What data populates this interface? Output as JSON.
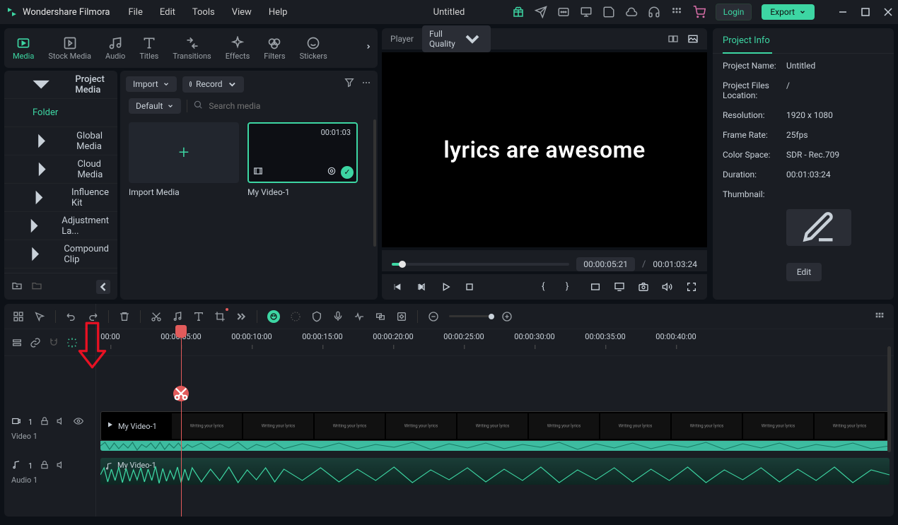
{
  "app_name": "Wondershare Filmora",
  "menu": [
    "File",
    "Edit",
    "Tools",
    "View",
    "Help"
  ],
  "doc_title": "Untitled",
  "login": "Login",
  "export": "Export",
  "tabs": [
    {
      "label": "Media",
      "active": true
    },
    {
      "label": "Stock Media"
    },
    {
      "label": "Audio"
    },
    {
      "label": "Titles"
    },
    {
      "label": "Transitions"
    },
    {
      "label": "Effects"
    },
    {
      "label": "Filters"
    },
    {
      "label": "Stickers"
    }
  ],
  "sidebar": {
    "items": [
      {
        "label": "Project Media",
        "head": true
      },
      {
        "label": "Folder",
        "flat": true
      },
      {
        "label": "Global Media"
      },
      {
        "label": "Cloud Media"
      },
      {
        "label": "Influence Kit"
      },
      {
        "label": "Adjustment La..."
      },
      {
        "label": "Compound Clip"
      }
    ]
  },
  "media_panel": {
    "import": "Import",
    "record": "Record",
    "default_dd": "Default",
    "search_placeholder": "Search media",
    "import_label": "Import Media",
    "clip": {
      "name": "My Video-1",
      "duration": "00:01:03"
    }
  },
  "player": {
    "label": "Player",
    "quality": "Full Quality",
    "preview_text": "lyrics are awesome",
    "current": "00:00:05:21",
    "total": "00:01:03:24"
  },
  "project_info": {
    "tab": "Project Info",
    "rows": {
      "name": {
        "label": "Project Name:",
        "value": "Untitled"
      },
      "location": {
        "label": "Project Files Location:",
        "value": "/"
      },
      "resolution": {
        "label": "Resolution:",
        "value": "1920 x 1080"
      },
      "framerate": {
        "label": "Frame Rate:",
        "value": "25fps"
      },
      "colorspace": {
        "label": "Color Space:",
        "value": "SDR - Rec.709"
      },
      "duration": {
        "label": "Duration:",
        "value": "00:01:03:24"
      },
      "thumbnail": {
        "label": "Thumbnail:"
      }
    },
    "edit": "Edit"
  },
  "timeline": {
    "ticks": [
      "00:00",
      "00:00:05:00",
      "00:00:10:00",
      "00:00:15:00",
      "00:00:20:00",
      "00:00:25:00",
      "00:00:30:00",
      "00:00:35:00",
      "00:00:40:00"
    ],
    "video_track": {
      "label": "Video 1",
      "badge": "1"
    },
    "audio_track": {
      "label": "Audio 1",
      "badge": "1"
    },
    "video_clip": "My Video-1",
    "audio_clip": "My Video-1",
    "frame_text": "Writing your lyrics"
  }
}
